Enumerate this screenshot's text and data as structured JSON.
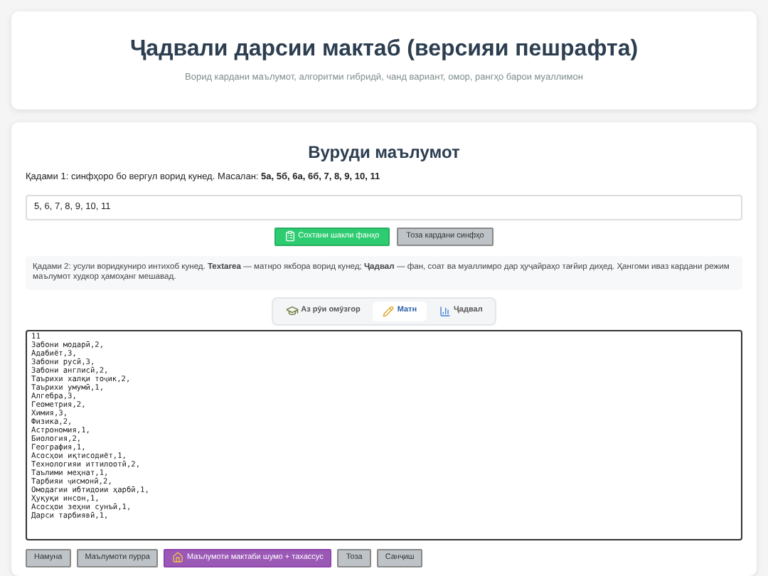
{
  "header": {
    "title": "Ҷадвали дарсии мактаб (версияи пешрафта)",
    "subtitle": "Ворид кардани маълумот, алгоритми гибридӣ, чанд вариант, омор, рангҳо барои муаллимон"
  },
  "input_section": {
    "title": "Вуруди маълумот",
    "step1": "Қадами 1: синфҳоро бо вергул ворид кунед. Масалан: **5а, 5б, 6а, 6б, 7, 8, 9, 10, 11**",
    "classes_value": "5, 6, 7, 8, 9, 10, 11",
    "class_buttons": [
      {
        "label": "Сохтани шакли фанҳо",
        "kind": "primary"
      },
      {
        "label": "Тоза кардани синфҳо",
        "kind": "secondary"
      }
    ],
    "step2": "Қадами 2: усули воридкуниро интихоб кунед. **Textarea** — матнро якбора ворид кунед; **Ҷадвал** — фан, соат ва муаллимро дар ҳуҷайраҳо тағйир диҳед. Ҳангоми иваз кардани режим маълумот худкор ҳамоҳанг мешавад.",
    "tabs": [
      {
        "label": "Аз рӯи омӯзгор",
        "selected": false
      },
      {
        "label": "Матн",
        "selected": true
      },
      {
        "label": "Ҷадвал",
        "selected": false
      }
    ],
    "textarea_value": "11\nЗабони модарӣ,2,\nАдабиёт,3,\nЗабони русӣ,3,\nЗабони англисӣ,2,\nТаърихи халқи тоҷик,2,\nТаърихи умумӣ,1,\nАлгебра,3,\nГеометрия,2,\nХимия,3,\nФизика,2,\nАстрономия,1,\nБиология,2,\nГеография,1,\nАсосҳои иқтисодиёт,1,\nТехнологияи иттилоотӣ,2,\nТаълими меҳнат,1,\nТарбияи ҷисмонӣ,2,\nОмодагии ибтидоии ҳарбӣ,1,\nҲуқуқи инсон,1,\nАсосҳои зеҳни сунъӣ,1,\nДарси тарбиявӣ,1,",
    "action_buttons": [
      {
        "label": "Намуна",
        "kind": "secondary"
      },
      {
        "label": "Маълумоти пурра",
        "kind": "secondary"
      },
      {
        "label": "Маълумоти мактаби шумо + тахассус",
        "kind": "accent"
      },
      {
        "label": "Тоза",
        "kind": "secondary"
      },
      {
        "label": "Санҷиш",
        "kind": "secondary"
      }
    ]
  }
}
